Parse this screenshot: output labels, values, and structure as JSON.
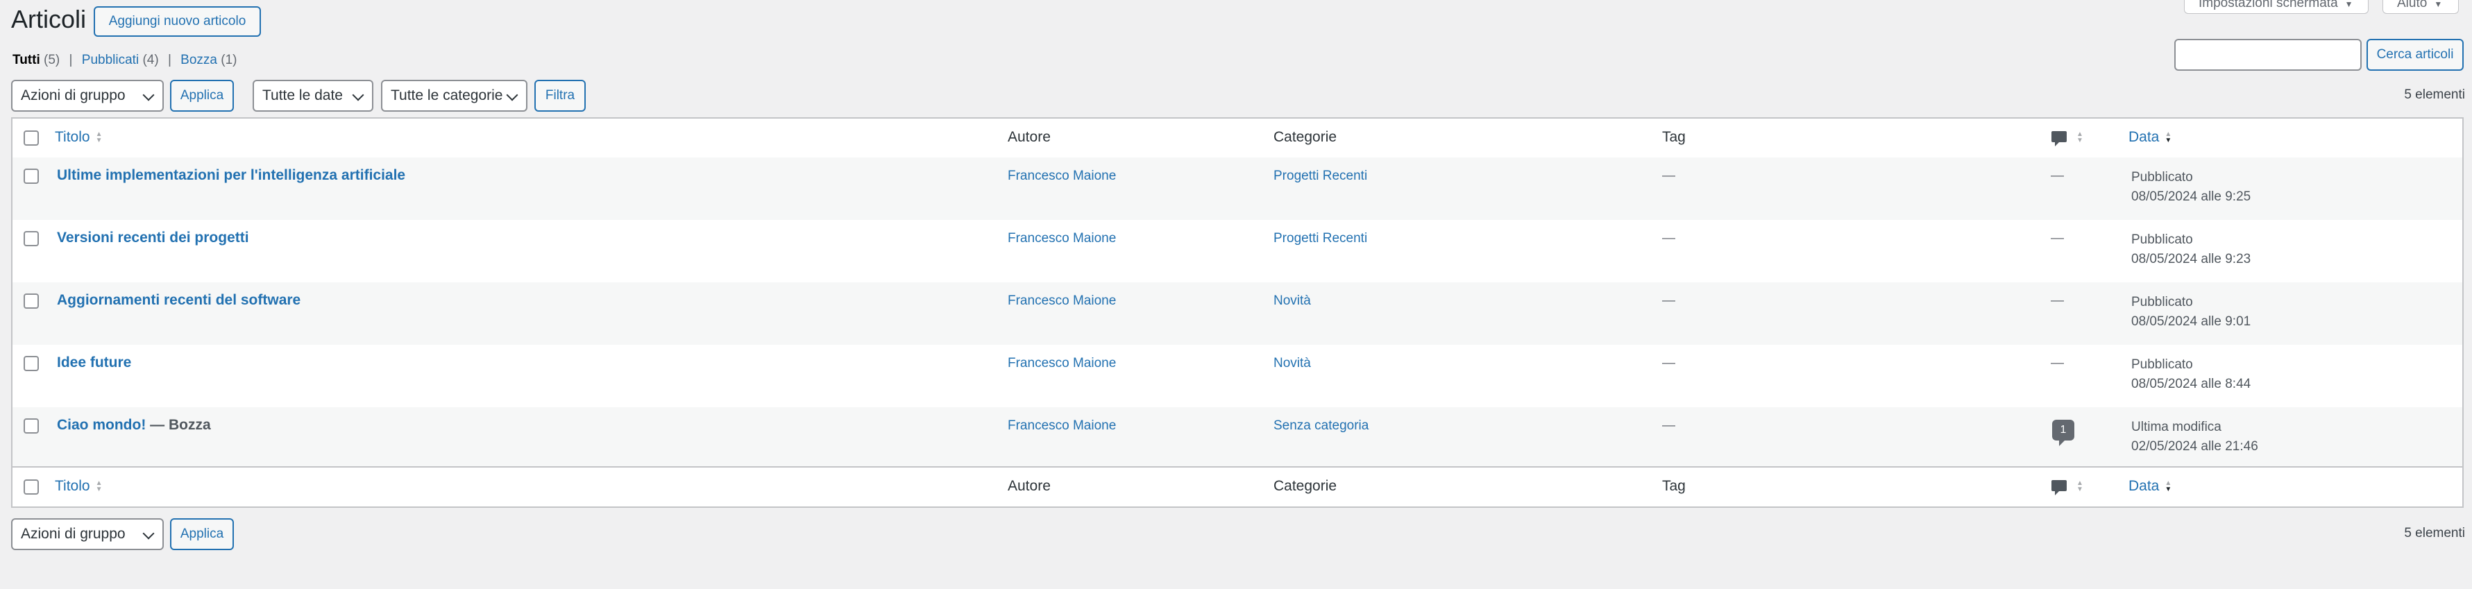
{
  "screen_meta": {
    "screen_options_label": "Impostazioni schermata",
    "help_label": "Aiuto"
  },
  "header": {
    "title": "Articoli",
    "add_new_label": "Aggiungi nuovo articolo"
  },
  "views": [
    {
      "label": "Tutti",
      "count": "(5)",
      "current": true
    },
    {
      "label": "Pubblicati",
      "count": "(4)",
      "current": false
    },
    {
      "label": "Bozza",
      "count": "(1)",
      "current": false
    }
  ],
  "view_separator": "|",
  "search": {
    "value": "",
    "button_label": "Cerca articoli"
  },
  "filters": {
    "bulk_actions_label": "Azioni di gruppo",
    "apply_label": "Applica",
    "dates_label": "Tutte le date",
    "categories_label": "Tutte le categorie",
    "filter_label": "Filtra"
  },
  "items_count": "5 elementi",
  "columns": {
    "title": "Titolo",
    "author": "Autore",
    "categories": "Categorie",
    "tags": "Tag",
    "comments_icon": "comment-icon",
    "date": "Data"
  },
  "posts": [
    {
      "title": "Ultime implementazioni per l'intelligenza artificiale",
      "state": "",
      "author": "Francesco Maione",
      "category": "Progetti Recenti",
      "tags": "—",
      "comments": "—",
      "status": "Pubblicato",
      "date": "08/05/2024 alle 9:25"
    },
    {
      "title": "Versioni recenti dei progetti",
      "state": "",
      "author": "Francesco Maione",
      "category": "Progetti Recenti",
      "tags": "—",
      "comments": "—",
      "status": "Pubblicato",
      "date": "08/05/2024 alle 9:23"
    },
    {
      "title": "Aggiornamenti recenti del software",
      "state": "",
      "author": "Francesco Maione",
      "category": "Novità",
      "tags": "—",
      "comments": "—",
      "status": "Pubblicato",
      "date": "08/05/2024 alle 9:01"
    },
    {
      "title": "Idee future",
      "state": "",
      "author": "Francesco Maione",
      "category": "Novità",
      "tags": "—",
      "comments": "—",
      "status": "Pubblicato",
      "date": "08/05/2024 alle 8:44"
    },
    {
      "title": "Ciao mondo!",
      "state": " — Bozza",
      "author": "Francesco Maione",
      "category": "Senza categoria",
      "tags": "—",
      "comments": "1",
      "status": "Ultima modifica",
      "date": "02/05/2024 alle 21:46"
    }
  ],
  "colors": {
    "accent": "#2271b1",
    "background": "#f0f0f1",
    "row_alt": "#f6f7f7"
  }
}
